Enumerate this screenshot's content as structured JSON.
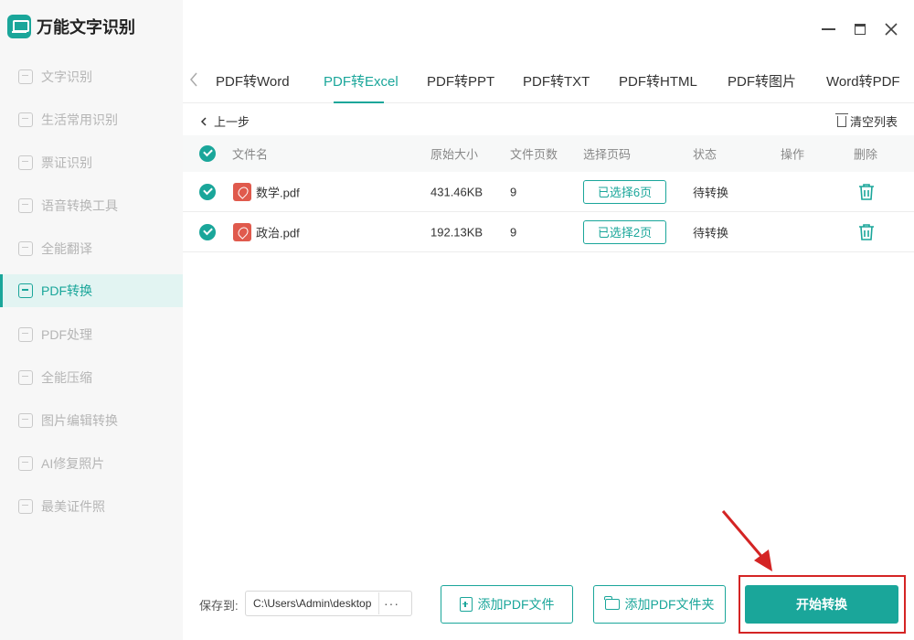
{
  "app": {
    "title": "万能文字识别"
  },
  "sidebar": {
    "items": [
      {
        "label": "文字识别"
      },
      {
        "label": "生活常用识别"
      },
      {
        "label": "票证识别"
      },
      {
        "label": "语音转换工具"
      },
      {
        "label": "全能翻译"
      },
      {
        "label": "PDF转换"
      },
      {
        "label": "PDF处理"
      },
      {
        "label": "全能压缩"
      },
      {
        "label": "图片编辑转换"
      },
      {
        "label": "AI修复照片"
      },
      {
        "label": "最美证件照"
      }
    ],
    "active_index": 5
  },
  "tabs": {
    "items": [
      "PDF转Word",
      "PDF转Excel",
      "PDF转PPT",
      "PDF转TXT",
      "PDF转HTML",
      "PDF转图片",
      "Word转PDF"
    ],
    "active": "PDF转Excel"
  },
  "toolbar": {
    "back_label": "上一步",
    "clear_label": "清空列表"
  },
  "table": {
    "headers": [
      "文件名",
      "原始大小",
      "文件页数",
      "选择页码",
      "状态",
      "操作",
      "删除"
    ],
    "rows": [
      {
        "name": "数学.pdf",
        "size": "431.46KB",
        "pages": "9",
        "selected": "已选择6页",
        "status": "待转换"
      },
      {
        "name": "政治.pdf",
        "size": "192.13KB",
        "pages": "9",
        "selected": "已选择2页",
        "status": "待转换"
      }
    ]
  },
  "bottom": {
    "save_label": "保存到:",
    "save_path": "C:\\Users\\Admin\\desktop",
    "browse_label": "···",
    "add_file_label": "添加PDF文件",
    "add_folder_label": "添加PDF文件夹",
    "start_label": "开始转换"
  },
  "colors": {
    "accent": "#1aa69a",
    "pdf_icon": "#e05a4d",
    "highlight": "#d42424"
  }
}
